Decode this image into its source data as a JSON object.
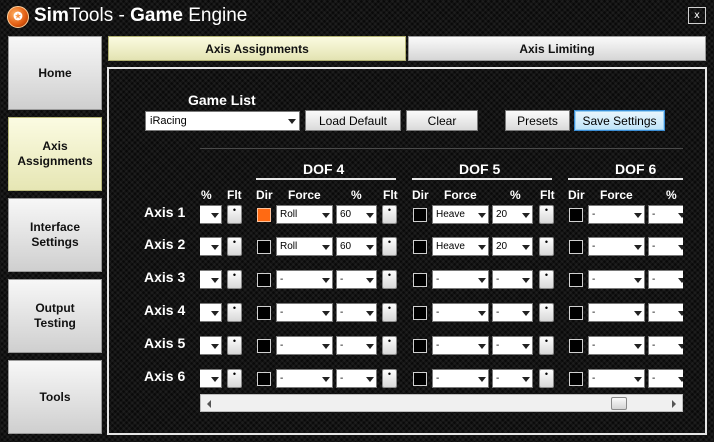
{
  "window": {
    "title_sim": "Sim",
    "title_tools": "Tools - ",
    "title_game": "Game",
    "title_engine": " Engine",
    "logo_icon": "simtools-logo-icon",
    "close_label": "x"
  },
  "nav": {
    "items": [
      {
        "label": "Home"
      },
      {
        "label": "Axis Assignments"
      },
      {
        "label": "Interface Settings"
      },
      {
        "label": "Output Testing"
      },
      {
        "label": "Tools"
      }
    ],
    "active": "Axis Assignments"
  },
  "tabs": [
    {
      "label": "Axis Assignments",
      "active": true
    },
    {
      "label": "Axis Limiting",
      "active": false
    }
  ],
  "game_list": {
    "label": "Game List",
    "selected": "iRacing"
  },
  "buttons": {
    "load_default": "Load Default",
    "clear": "Clear",
    "presets": "Presets",
    "save_settings": "Save Settings"
  },
  "partial": {
    "percent_header": "%",
    "flt_header": "Flt"
  },
  "dof": [
    {
      "title": "DOF 4",
      "dir_header": "Dir",
      "force_header": "Force",
      "percent_header": "%",
      "flt_header": "Flt"
    },
    {
      "title": "DOF 5",
      "dir_header": "Dir",
      "force_header": "Force",
      "percent_header": "%",
      "flt_header": "Flt"
    },
    {
      "title": "DOF 6",
      "dir_header": "Dir",
      "force_header": "Force",
      "percent_header": "%"
    }
  ],
  "axes": [
    {
      "label": "Axis 1",
      "dof4": {
        "dir_checked": true,
        "force": "Roll",
        "percent": "60"
      },
      "dof5": {
        "force": "Heave",
        "percent": "20"
      },
      "dof6": {
        "force": "-",
        "percent": "-"
      }
    },
    {
      "label": "Axis 2",
      "dof4": {
        "dir_checked": false,
        "force": "Roll",
        "percent": "60"
      },
      "dof5": {
        "force": "Heave",
        "percent": "20"
      },
      "dof6": {
        "force": "-",
        "percent": "-"
      }
    },
    {
      "label": "Axis 3",
      "dof4": {
        "dir_checked": false,
        "force": "-",
        "percent": "-"
      },
      "dof5": {
        "force": "-",
        "percent": "-"
      },
      "dof6": {
        "force": "-",
        "percent": "-"
      }
    },
    {
      "label": "Axis 4",
      "dof4": {
        "dir_checked": false,
        "force": "-",
        "percent": "-"
      },
      "dof5": {
        "force": "-",
        "percent": "-"
      },
      "dof6": {
        "force": "-",
        "percent": "-"
      }
    },
    {
      "label": "Axis 5",
      "dof4": {
        "dir_checked": false,
        "force": "-",
        "percent": "-"
      },
      "dof5": {
        "force": "-",
        "percent": "-"
      },
      "dof6": {
        "force": "-",
        "percent": "-"
      }
    },
    {
      "label": "Axis 6",
      "dof4": {
        "dir_checked": false,
        "force": "-",
        "percent": "-"
      },
      "dof5": {
        "force": "-",
        "percent": "-"
      },
      "dof6": {
        "force": "-",
        "percent": "-"
      }
    }
  ],
  "flt_button_glyph": "•",
  "colors": {
    "dir_checked": "#ff6a13",
    "active_tab": "#f5f5c8",
    "save_highlight": "#bfe4f8"
  }
}
